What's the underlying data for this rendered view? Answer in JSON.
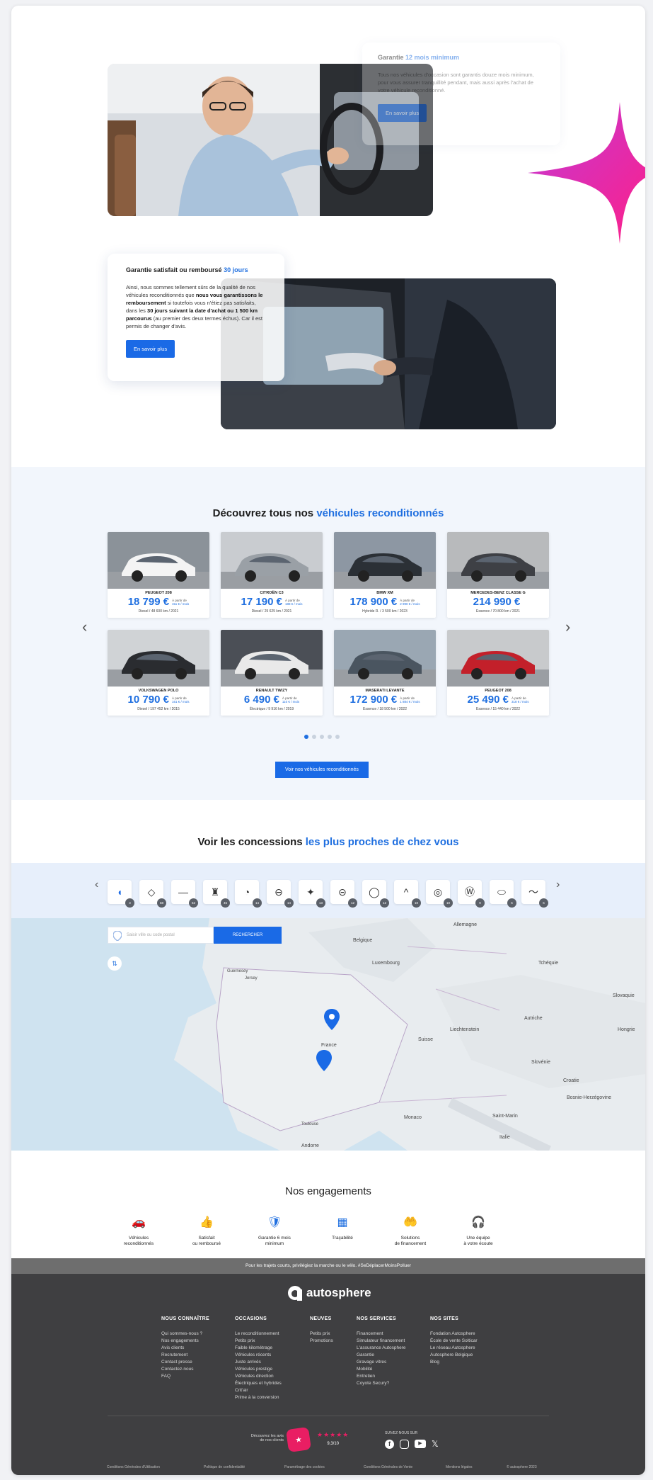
{
  "guarantee_one": {
    "title_prefix": "Garantie",
    "title_highlight": "12 mois minimum",
    "body": "Tous nos véhicules d'occasion sont garantis douze mois minimum, pour vous assurer tranquillité pendant, mais aussi après l'achat de votre véhicule reconditionné.",
    "cta": "En savoir plus"
  },
  "guarantee_two": {
    "title_prefix": "Garantie satisfait ou remboursé",
    "title_highlight": "30 jours",
    "body_1": "Ainsi, nous sommes tellement sûrs de la qualité de nos véhicules reconditionnés que ",
    "body_bold_1": "nous vous garantissons le remboursement",
    "body_2": " si toutefois vous n'étiez pas satisfaits, dans les ",
    "body_bold_2": "30 jours suivant la date d'achat ou 1 500 km parcourus",
    "body_3": " (au premier des deux termes échus). Car il est permis de changer d'avis.",
    "cta": "En savoir plus"
  },
  "vehicles": {
    "title_prefix": "Découvrez tous nos",
    "title_highlight": "véhicules reconditionnés",
    "cta": "Voir nos véhicules reconditionnés",
    "prev_icon": "chevron-left-icon",
    "next_icon": "chevron-right-icon",
    "cars": [
      {
        "name": "PEUGEOT 208",
        "price": "18 799 €",
        "from": "À partir de",
        "monthly": "311 € / mois",
        "details": "Diesel / 48 600 km / 2021",
        "body": "#f4f4f4",
        "bg": "#8b9299"
      },
      {
        "name": "CITROËN C3",
        "price": "17 190 €",
        "from": "À partir de",
        "monthly": "188 € / mois",
        "details": "Diesel / 25 625 km / 2021",
        "body": "#9aa0a6",
        "bg": "#c9ccd0"
      },
      {
        "name": "BMW XM",
        "price": "178 900 €",
        "from": "À partir de",
        "monthly": "2 990 € / mois",
        "details": "Hybride R. / 3 500 km / 2023",
        "body": "#2b3036",
        "bg": "#8d97a3"
      },
      {
        "name": "MERCEDES-BENZ CLASSE G",
        "price": "214 990 €",
        "from": "",
        "monthly": "",
        "details": "Essence / 70 800 km / 2021",
        "body": "#3e4045",
        "bg": "#b8babc"
      },
      {
        "name": "VOLKSWAGEN POLO",
        "price": "10 790 €",
        "from": "À partir de",
        "monthly": "161 € / mois",
        "details": "Diesel / 197 452 km / 2015",
        "body": "#2a2c30",
        "bg": "#d0d3d6"
      },
      {
        "name": "RENAULT TWIZY",
        "price": "6 490 €",
        "from": "À partir de",
        "monthly": "110 € / mois",
        "details": "Électrique / 9 916 km / 2019",
        "body": "#e9e9e9",
        "bg": "#4b4f56"
      },
      {
        "name": "MASERATI LEVANTE",
        "price": "172 900 €",
        "from": "À partir de",
        "monthly": "1 884 € / mois",
        "details": "Essence / 18 500 km / 2022",
        "body": "#4a5560",
        "bg": "#9aa7b3"
      },
      {
        "name": "PEUGEOT 208",
        "price": "25 490 €",
        "from": "À partir de",
        "monthly": "318 € / mois",
        "details": "Essence / 15 440 km / 2022",
        "body": "#c3202a",
        "bg": "#c8cacc"
      }
    ],
    "pagination_count": 5,
    "active_page": 0
  },
  "concessions": {
    "title_prefix": "Voir les concessions",
    "title_highlight": "les plus proches de chez vous",
    "prev_icon": "chevron-left-icon",
    "next_icon": "chevron-right-icon",
    "brands": [
      {
        "name": "autosphere-logo-icon",
        "count": "3"
      },
      {
        "name": "renault-logo-icon",
        "count": "68"
      },
      {
        "name": "skoda-logo-icon",
        "count": "52"
      },
      {
        "name": "peugeot-logo-icon",
        "count": "45"
      },
      {
        "name": "bmw-logo-icon",
        "count": "14"
      },
      {
        "name": "opel-logo-icon",
        "count": "14"
      },
      {
        "name": "mercedes-logo-icon",
        "count": "13"
      },
      {
        "name": "mini-logo-icon",
        "count": "12"
      },
      {
        "name": "ford-logo-icon",
        "count": "12"
      },
      {
        "name": "citroen-logo-icon",
        "count": "10"
      },
      {
        "name": "toyota-logo-icon",
        "count": "10"
      },
      {
        "name": "volkswagen-logo-icon",
        "count": "9"
      },
      {
        "name": "land-rover-logo-icon",
        "count": "6"
      },
      {
        "name": "jaguar-logo-icon",
        "count": "6"
      }
    ],
    "search_placeholder": "Saisir ville ou code postal",
    "search_button": "RECHERCHER",
    "filter_icon": "sliders-icon",
    "map_labels": {
      "allemagne": "Allemagne",
      "belgique": "Belgique",
      "luxembourg": "Luxembourg",
      "tcheque": "Tchéquie",
      "slovaquie": "Slovaquie",
      "autriche": "Autriche",
      "hongrie": "Hongrie",
      "guernesey": "Guernesey",
      "jersey": "Jersey",
      "france": "France",
      "suisse": "Suisse",
      "liechtenstein": "Liechtenstein",
      "slovenie": "Slovénie",
      "croatie": "Croatie",
      "bosnie": "Bosnie-Herzégovine",
      "monaco": "Monaco",
      "saint_marin": "Saint-Marin",
      "italie": "Italie",
      "andorre": "Andorre",
      "toulouse": "Toulouse"
    }
  },
  "engagements": {
    "title": "Nos engagements",
    "items": [
      {
        "icon": "car-check-icon",
        "line1": "Véhicules",
        "line2": "reconditionnés"
      },
      {
        "icon": "thumb-up-icon",
        "line1": "Satisfait",
        "line2": "ou remboursé"
      },
      {
        "icon": "shield-badge-icon",
        "line1": "Garantie 6 mois",
        "line2": "minimum"
      },
      {
        "icon": "barcode-search-icon",
        "line1": "Traçabilité",
        "line2": ""
      },
      {
        "icon": "hand-coins-icon",
        "line1": "Solutions",
        "line2": "de financement"
      },
      {
        "icon": "headset-icon",
        "line1": "Une équipe",
        "line2": "à votre écoute"
      }
    ]
  },
  "banner": "Pour les trajets courts, privilégiez la marche ou le vélo. #SeDéplacerMoinsPolluer",
  "footer": {
    "brand": "autosphere",
    "columns": [
      {
        "heading": "NOUS CONNAÎTRE",
        "items": [
          "Qui sommes-nous ?",
          "Nos engagements",
          "Avis clients",
          "Recrutement",
          "Contact presse",
          "Contactez-nous",
          "FAQ"
        ]
      },
      {
        "heading": "OCCASIONS",
        "items": [
          "Le reconditionnement",
          "Petits prix",
          "Faible kilométrage",
          "Véhicules récents",
          "Juste arrivés",
          "Véhicules prestige",
          "Véhicules direction",
          "Électriques et hybrides",
          "Crit'air",
          "Prime à la conversion"
        ]
      },
      {
        "heading": "NEUVES",
        "items": [
          "Petits prix",
          "Promotions"
        ]
      },
      {
        "heading": "NOS SERVICES",
        "items": [
          "Financement",
          "Simulateur financement",
          "L'assurance Autosphere",
          "Garantie",
          "Gravage vitres",
          "Mobilité",
          "Entretien",
          "Coyote Secury?"
        ]
      },
      {
        "heading": "NOS SITES",
        "items": [
          "Fondation Autosphere",
          "École de vente Solticar",
          "Le réseau Autosphere",
          "Autosphere Belgique",
          "Blog"
        ]
      }
    ],
    "reviews_text_1": "Découvrez les avis",
    "reviews_text_2": "de nos clients",
    "reviews_score": "9,3/10",
    "social_title": "SUIVEZ-NOUS SUR",
    "legal": [
      "Conditions Générales d'Utilisation",
      "Politique de confidentialité",
      "Paramétrage des cookies",
      "Conditions Générales de Vente",
      "Mentions légales",
      "© autosphere 2023"
    ]
  },
  "colors": {
    "accent": "#1f6fe0",
    "footer": "#3f3f41",
    "sparkle": "#f0239a"
  }
}
